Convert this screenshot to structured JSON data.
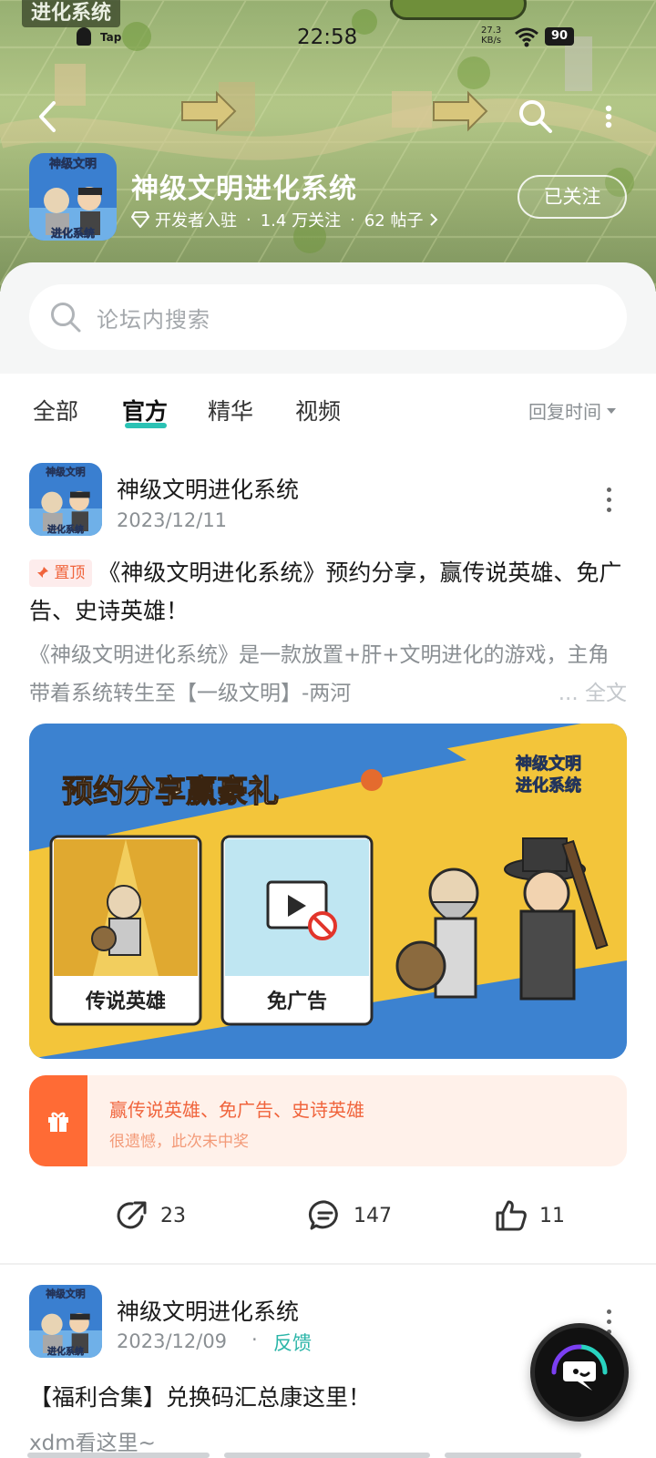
{
  "status_bar": {
    "time": "22:58",
    "app_badge": "Tap",
    "net_speed": "27.3",
    "net_unit": "KB/s",
    "battery": "90"
  },
  "header": {
    "corner_logo": "进化系统",
    "title": "神级文明进化系统",
    "developer_badge": "开发者入驻",
    "followers": "1.4 万关注",
    "posts": "62 帖子",
    "follow_label": "已关注"
  },
  "search": {
    "placeholder": "论坛内搜索"
  },
  "tabs": {
    "items": [
      "全部",
      "官方",
      "精华",
      "视频"
    ],
    "active": "官方",
    "sort_label": "回复时间"
  },
  "posts": [
    {
      "author": "神级文明进化系统",
      "date": "2023/12/11",
      "pin_label": "置顶",
      "title": "《神级文明进化系统》预约分享，赢传说英雄、免广告、史诗英雄！",
      "excerpt": "《神级文明进化系统》是一款放置+肝+文明进化的游戏，主角带着系统转生至【一级文明】-两河",
      "read_more": "... 全文",
      "image": {
        "headline": "预约分享赢豪礼",
        "logo_line1": "神级文明",
        "logo_line2": "进化系统",
        "card1_label": "传说英雄",
        "card2_label": "免广告"
      },
      "lottery": {
        "title": "赢传说英雄、免广告、史诗英雄",
        "status": "很遗憾，此次未中奖"
      },
      "shares": "23",
      "comments": "147",
      "likes": "11"
    },
    {
      "author": "神级文明进化系统",
      "date": "2023/12/09",
      "dot": "·",
      "tag": "反馈",
      "title": "【福利合集】兑换码汇总康这里！",
      "excerpt": "xdm看这里~"
    }
  ],
  "avatar_text": {
    "top": "神级文明",
    "bottom": "进化系统"
  },
  "colors": {
    "accent": "#2bc2b4",
    "pin_red": "#f0643c",
    "lottery_orange": "#ff6b35",
    "banner_green": "#a3b87a"
  }
}
